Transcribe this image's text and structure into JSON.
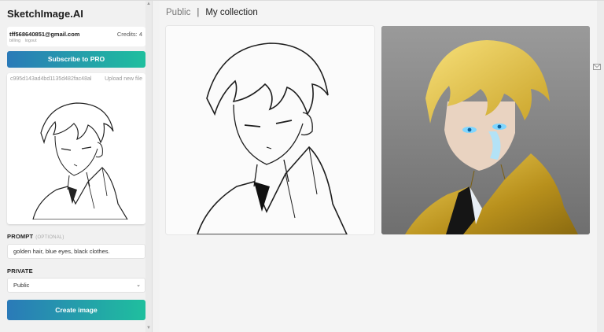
{
  "sidebar": {
    "brand": "SketchImage.AI",
    "account": {
      "email": "tff568640851@gmail.com",
      "billing": "billing",
      "logout": "logout",
      "credits": "Credits: 4"
    },
    "subscribe_label": "Subscribe to PRO",
    "upload": {
      "file_hash": "c995d143ad4bd1135d482fac48al",
      "upload_new": "Upload new file"
    },
    "prompt": {
      "label": "PROMPT",
      "optional": "(OPTIONAL)",
      "value": "golden hair, blue eyes, black clothes."
    },
    "private": {
      "label": "PRIVATE",
      "selected": "Public"
    },
    "create_label": "Create image"
  },
  "main": {
    "tabs": {
      "public": "Public",
      "separator": "|",
      "mine": "My collection"
    }
  },
  "colors": {
    "accent_start": "#2a7ab8",
    "accent_end": "#1fbf9e"
  }
}
